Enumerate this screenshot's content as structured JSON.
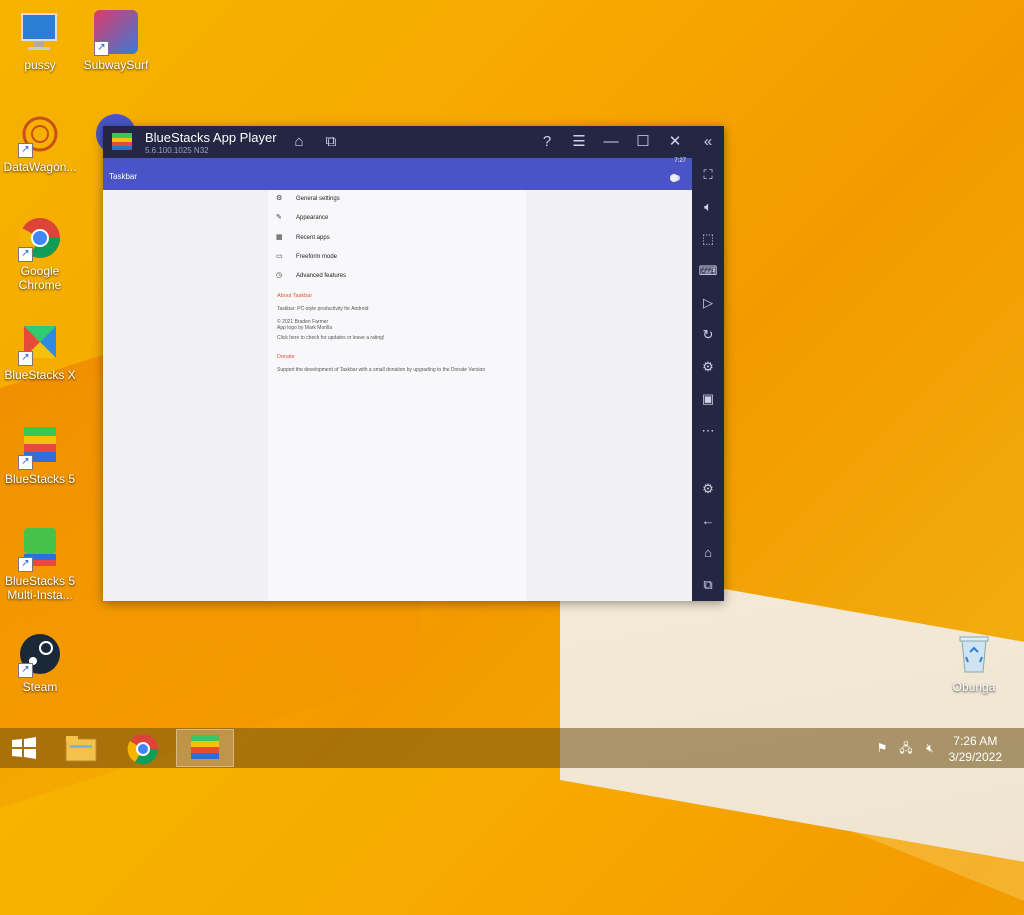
{
  "desktop": {
    "icons": [
      {
        "label": "pussy"
      },
      {
        "label": "SubwaySurf"
      },
      {
        "label": "DataWagon..."
      },
      {
        "label": "Google Chrome"
      },
      {
        "label": "BlueStacks X"
      },
      {
        "label": "BlueStacks 5"
      },
      {
        "label": "BlueStacks 5 Multi-Insta..."
      },
      {
        "label": "Steam"
      },
      {
        "label": "Obunga"
      }
    ]
  },
  "window": {
    "title": "BlueStacks App Player",
    "version": "5.6.100.1025 N32",
    "status_text": "7:27",
    "app_title": "Taskbar",
    "settings": [
      {
        "label": "General settings",
        "icon": "gear-icon"
      },
      {
        "label": "Appearance",
        "icon": "brush-icon"
      },
      {
        "label": "Recent apps",
        "icon": "grid-icon"
      },
      {
        "label": "Freeform mode",
        "icon": "window-icon"
      },
      {
        "label": "Advanced features",
        "icon": "clock-icon"
      }
    ],
    "about": {
      "heading": "About Taskbar",
      "line1": "Taskbar: PC-style productivity for Android",
      "line2": "© 2021 Braden Farmer",
      "line3": "App logo by Mark Morilla",
      "line4": "Click here to check for updates or leave a rating!"
    },
    "donate": {
      "heading": "Donate",
      "text": "Support the development of Taskbar with a small donation by upgrading to the Donate Version"
    }
  },
  "taskbar": {
    "time": "7:26 AM",
    "date": "3/29/2022"
  }
}
